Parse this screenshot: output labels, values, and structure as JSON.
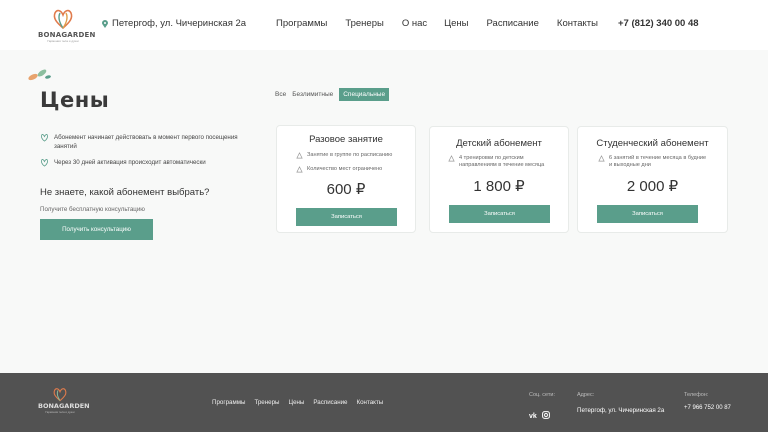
{
  "header": {
    "logo_text": "BONAGARDEN",
    "logo_sub": "Гармония тела и души",
    "address": "Петергоф, ул. Чичеринская 2а",
    "nav": [
      "Программы",
      "Тренеры",
      "О нас",
      "Цены",
      "Расписание",
      "Контакты"
    ],
    "phone": "+7 (812) 340 00 48"
  },
  "page": {
    "title": "Цены",
    "info": [
      "Абонемент начинает действовать в момент первого посещения занятий",
      "Через 30 дней активация происходит автоматически"
    ],
    "question": "Не знаете, какой абонемент выбрать?",
    "consult_note": "Получите бесплатную консультацию",
    "consult_button": "Получить консультацию"
  },
  "tabs": [
    {
      "label": "Все",
      "active": false
    },
    {
      "label": "Безлимитные",
      "active": false
    },
    {
      "label": "Специальные",
      "active": true
    }
  ],
  "cards": [
    {
      "title": "Разовое занятие",
      "features": [
        "Занятие в группе по расписанию",
        "Количество мест ограничено"
      ],
      "price": "600 ₽",
      "button": "Записаться"
    },
    {
      "title": "Детский абонемент",
      "features": [
        "4 тренировки по детским направлениям в течение месяца"
      ],
      "price": "1 800 ₽",
      "button": "Записаться"
    },
    {
      "title": "Студенческий абонемент",
      "features": [
        "6 занятий в течение месяца в будние и выходные дни"
      ],
      "price": "2 000 ₽",
      "button": "Записаться"
    }
  ],
  "footer": {
    "logo_text": "BONAGARDEN",
    "logo_sub": "Гармония тела и души",
    "nav": [
      "Программы",
      "Тренеры",
      "Цены",
      "Расписание",
      "Контакты"
    ],
    "social_label": "Соц. сети:",
    "address_label": "Адрес:",
    "address": "Петергоф, ул. Чичеринская 2а",
    "phone_label": "Телефон:",
    "phone": "+7 966 752 00 87"
  },
  "colors": {
    "accent": "#5a9e8b",
    "footer_bg": "#525252"
  }
}
